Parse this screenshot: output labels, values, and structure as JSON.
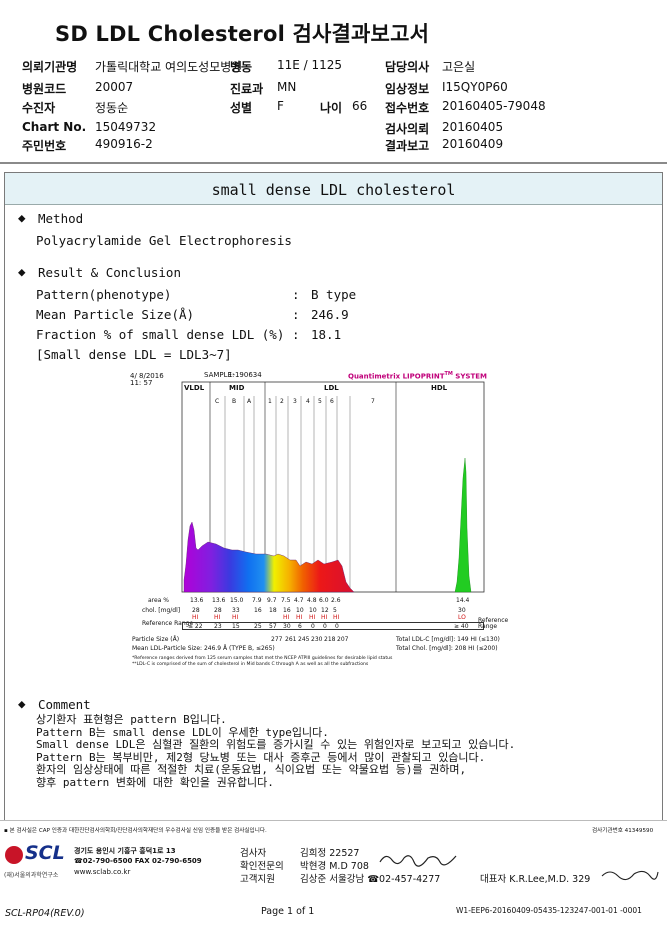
{
  "title": "SD LDL Cholesterol 검사결과보고서",
  "header": {
    "institution_label": "의뢰기관명",
    "institution": "가톨릭대학교 여의도성모병원",
    "ward_label": "병동",
    "ward": "11E / 1125",
    "doctor_label": "담당의사",
    "doctor": "고은실",
    "hospital_code_label": "병원코드",
    "hospital_code": "20007",
    "dept_label": "진료과",
    "dept": "MN",
    "clinical_label": "임상정보",
    "clinical": "I15QY0P60",
    "patient_label": "수진자",
    "patient": "정동순",
    "sex_label": "성별",
    "sex": "F",
    "age_label": "나이",
    "age": "66",
    "receipt_label": "접수번호",
    "receipt": "20160405-79048",
    "chart_label": "Chart No.",
    "chart": "15049732",
    "request_label": "검사의뢰",
    "request": "20160405",
    "resident_label": "주민번호",
    "resident": "490916-2",
    "report_label": "결과보고",
    "report": "20160409"
  },
  "panel_title": "small dense LDL cholesterol",
  "method": {
    "heading": "Method",
    "text": "Polyacrylamide Gel Electrophoresis"
  },
  "result": {
    "heading": "Result & Conclusion",
    "rows": [
      {
        "label": "Pattern(phenotype)",
        "sep": ":",
        "value": "B type"
      },
      {
        "label": "Mean Particle Size(Å)",
        "sep": ":",
        "value": "246.9"
      },
      {
        "label": "Fraction % of small dense LDL (%)",
        "sep": ":",
        "value": "18.1"
      }
    ],
    "note": "[Small dense LDL = LDL3~7]"
  },
  "figure": {
    "date": "4/ 8/2016",
    "time": "11: 57",
    "sample_label": "SAMPLE:",
    "sample": "1-190634",
    "brand": "Quantimetrix LIPOPRINT",
    "brand_tm": "TM",
    "brand_suffix": " SYSTEM",
    "band_groups": [
      "VLDL",
      "MID",
      "LDL",
      "HDL"
    ],
    "mid_bands": [
      "C",
      "B",
      "A"
    ],
    "ldl_bands": [
      "1",
      "2",
      "3",
      "4",
      "5",
      "6",
      "7"
    ],
    "area_label": "area %",
    "area_values": [
      "13.6",
      "13.6",
      "15.0",
      "7.9",
      "9.7",
      "7.5",
      "4.7",
      "4.8",
      "6.0",
      "2.6",
      "14.4"
    ],
    "chol_label": "chol. [mg/dl]",
    "chol_values": [
      "28",
      "28",
      "33",
      "16",
      "18",
      "16",
      "10",
      "10",
      "12",
      "5",
      "30"
    ],
    "flags": [
      "HI",
      "HI",
      "HI",
      "",
      "",
      "HI",
      "HI",
      "HI",
      "HI",
      "HI",
      "LO"
    ],
    "ref_label": "Reference Range",
    "ref_values": [
      "≤ 22",
      "23",
      "15",
      "25",
      "57",
      "30",
      "6",
      "0",
      "0",
      "0",
      "≥ 40"
    ],
    "particle_label": "Particle Size (Å)",
    "particle_values": [
      "277",
      "261",
      "245",
      "230",
      "218",
      "207"
    ],
    "total_ldl": "Total LDL-C [mg/dl]: 149  HI  (≤130)",
    "mean_ldl": "Mean LDL-Particle Size:   246.9 Å  (TYPE B, ≤265)",
    "total_chol": "Total Chol. [mg/dl]:  208  HI  (≤200)",
    "footnote1": "*Reference ranges derived from 125 serum samples that met the NCEP ATPIII guidelines for desirable lipid status",
    "footnote2": "**LDL-C is comprised of the sum of cholesterol in Mid bands C through A as well as all the subfractions",
    "colors": [
      "#b000d8",
      "#5a2ad8",
      "#1060e8",
      "#f0f000",
      "#f0a000",
      "#ee5000",
      "#e01020",
      "#22cc22"
    ]
  },
  "comment": {
    "heading": "Comment",
    "lines": [
      "상기환자 표현형은 pattern B입니다.",
      "Pattern B는 small dense LDL이 우세한 type입니다.",
      "Small dense LDL은 심혈관 질환의 위험도를 증가시킬 수 있는 위험인자로 보고되고 있습니다.",
      "Pattern B는 복부비만, 제2형 당뇨병 또는 대사 증후군 등에서 많이 관찰되고 있습니다.",
      "환자의 임상상태에 따른 적절한 치료(운동요법, 식이요법 또는 약물요법 등)를 권하며,",
      "향후 pattern 변화에 대한 확인을 권유합니다."
    ]
  },
  "footer": {
    "cert": "▪ 본 검사실은 CAP 인증과 대한진단검사의학회/진단검사의학재단의 우수검사실 신임 인증을 받은 검사실입니다.",
    "cert_no": "검사기관번호 41349590",
    "lab_name": "경기도 용인시 기흥구 흥덕1로 13",
    "lab_tel": "☎02-790-6500  FAX 02-790-6509",
    "lab_web": "www.sclab.co.kr",
    "lab_corp": "(재)서울의과학연구소",
    "logo": "SCL",
    "staff": [
      {
        "role": "검사자",
        "name": "김희정 22527"
      },
      {
        "role": "확인전문의",
        "name": "박현경 M.D 708"
      },
      {
        "role": "고객지원",
        "name": "김상준 서울강남 ☎02-457-4277"
      }
    ],
    "ceo": "대표자 K.R.Lee,M.D. 329",
    "form": "SCL-RP04(REV.0)",
    "page": "Page 1 of 1",
    "doc_id": "W1-EEP6-20160409-05435-123247-001-01 -0001"
  }
}
